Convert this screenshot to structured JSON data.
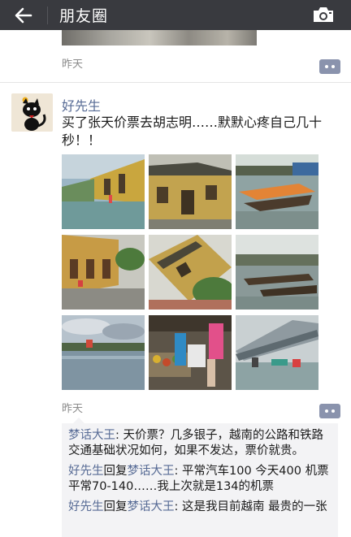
{
  "header": {
    "title": "朋友圈"
  },
  "previous_post": {
    "time": "昨天"
  },
  "post": {
    "author": "好先生",
    "text": "买了张天价票去胡志明……默默心疼自己几十秒！！",
    "time": "昨天",
    "photos": [
      {
        "name": "photo-flooded-street-1"
      },
      {
        "name": "photo-yellow-house-1"
      },
      {
        "name": "photo-river-boat-1"
      },
      {
        "name": "photo-street-umbrellas"
      },
      {
        "name": "photo-tilted-house"
      },
      {
        "name": "photo-river-boats-2"
      },
      {
        "name": "photo-river-landscape"
      },
      {
        "name": "photo-market-stall"
      },
      {
        "name": "photo-market-roof"
      }
    ]
  },
  "comments": [
    {
      "author": "梦话大王",
      "separator": ": ",
      "text": "天价票？几多银子，越南的公路和铁路交通基础状况如何，如果不发达，票价就贵。"
    },
    {
      "author": "好先生",
      "reply_word": "回复",
      "reply_to": "梦话大王",
      "separator": ": ",
      "text": "平常汽车100 今天400 机票平常70-140……我上次就是134的机票"
    },
    {
      "author": "好先生",
      "reply_word": "回复",
      "reply_to": "梦话大王",
      "separator": ": ",
      "text": "这是我目前越南 最贵的一张"
    }
  ],
  "colors": {
    "topbar": "#393a3f",
    "link_name": "#576b95",
    "comment_bg": "#f3f3f5",
    "comment_button": "#8a93ad"
  }
}
